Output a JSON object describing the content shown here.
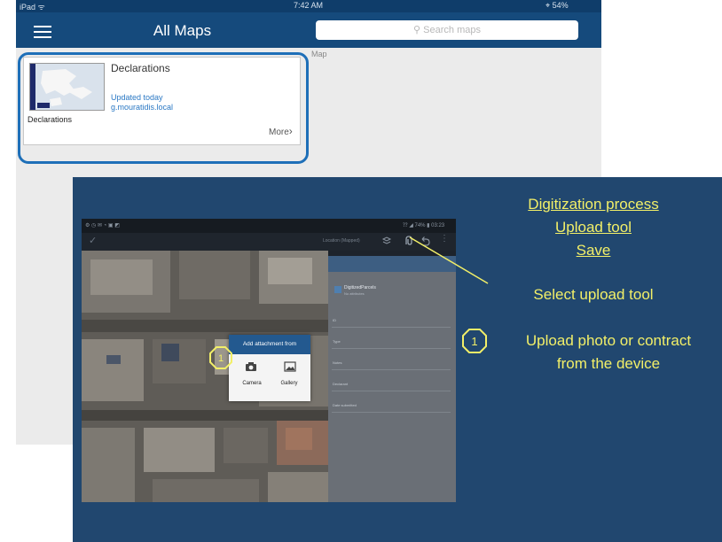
{
  "ipad": {
    "status": {
      "carrier": "iPad ᯤ",
      "time": "7:42 AM",
      "battery": "⌖ 54%"
    },
    "title": "All Maps",
    "search_placeholder": "Search maps",
    "map_label_stub": "Map",
    "card": {
      "title": "Declarations",
      "updated": "Updated today",
      "owner": "g.mouratidis.local",
      "subtitle": "Declarations",
      "more": "More"
    }
  },
  "phone": {
    "status_left": "⚙ ◷ ✉ ◔ ▣ ◩",
    "status_right": "⁇ ◢ 74% ▮ 03:23",
    "toolbar_text": "Location (Mapped)",
    "panel": {
      "feature_name": "DigitizedParcels",
      "feature_sub": "No attributes",
      "fields": [
        "ID",
        "Type",
        "Notes",
        "Declarant",
        "Date submitted"
      ]
    },
    "dialog": {
      "title": "Add attachment from",
      "camera_label": "Camera",
      "gallery_label": "Gallery"
    }
  },
  "slide": {
    "heading_lines": [
      "Digitization process",
      "Upload tool",
      "Save"
    ],
    "select_text": "Select upload tool",
    "step_number": "1",
    "step_text_lines": [
      "Upload photo or contract",
      "from the device"
    ],
    "accent_color": "#f2ef68",
    "background_color": "#21476f"
  },
  "icons": [
    "menu-icon",
    "search-icon",
    "chevron-right-icon",
    "check-icon",
    "upload-tool-icon",
    "undo-icon",
    "overflow-menu-icon",
    "camera-icon",
    "gallery-icon"
  ]
}
